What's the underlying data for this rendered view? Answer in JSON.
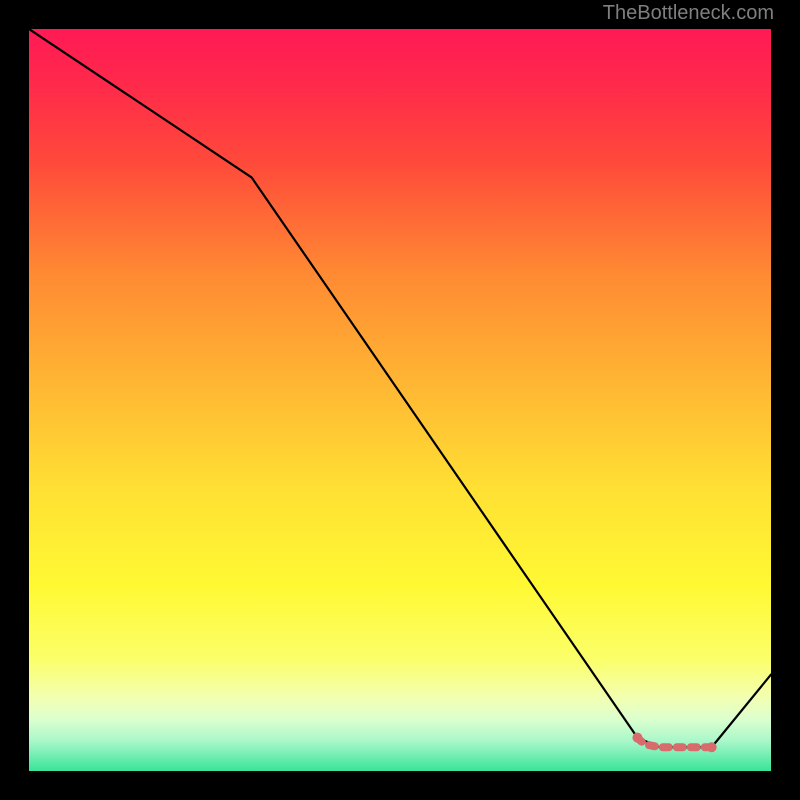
{
  "attribution": "TheBottleneck.com",
  "chart_data": {
    "type": "line",
    "title": "",
    "xlabel": "",
    "ylabel": "",
    "xlim": [
      0,
      100
    ],
    "ylim": [
      0,
      100
    ],
    "series": [
      {
        "name": "main-curve",
        "color": "#000000",
        "x": [
          0,
          30,
          82,
          85,
          92,
          100
        ],
        "values": [
          100,
          80,
          4.5,
          3.2,
          3.2,
          13
        ]
      },
      {
        "name": "highlighted-segment",
        "color": "#d86b6b",
        "x": [
          82,
          82.5,
          83.5,
          85,
          86,
          88,
          89,
          90,
          91,
          92
        ],
        "values": [
          4.5,
          4.0,
          3.5,
          3.2,
          3.2,
          3.2,
          3.2,
          3.2,
          3.2,
          3.2
        ]
      }
    ],
    "background_gradient": {
      "stops": [
        {
          "offset": 0.0,
          "color": "#ff1a55"
        },
        {
          "offset": 0.08,
          "color": "#ff2b4a"
        },
        {
          "offset": 0.18,
          "color": "#ff4a3a"
        },
        {
          "offset": 0.33,
          "color": "#ff8a33"
        },
        {
          "offset": 0.48,
          "color": "#ffb733"
        },
        {
          "offset": 0.62,
          "color": "#ffe033"
        },
        {
          "offset": 0.75,
          "color": "#fff933"
        },
        {
          "offset": 0.85,
          "color": "#fbff6a"
        },
        {
          "offset": 0.9,
          "color": "#f3ffb0"
        },
        {
          "offset": 0.93,
          "color": "#dcffcf"
        },
        {
          "offset": 0.96,
          "color": "#a8f7c9"
        },
        {
          "offset": 1.0,
          "color": "#39e49a"
        }
      ]
    }
  }
}
